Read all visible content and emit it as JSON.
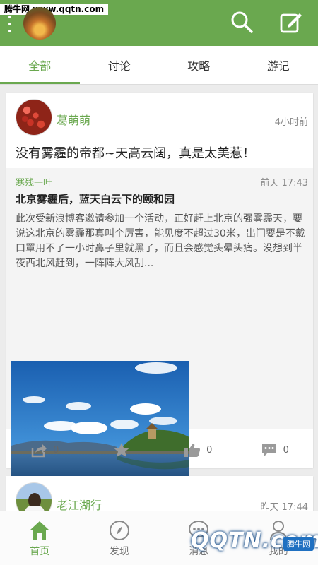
{
  "watermark": "腾牛网 www.qqtn.com",
  "tabs": [
    "全部",
    "讨论",
    "攻略",
    "游记"
  ],
  "posts": [
    {
      "user": "葛萌萌",
      "time": "4小时前",
      "title": "没有雾霾的帝都~天高云阔，真是太美惹！",
      "quote": {
        "author": "寒残一叶",
        "time": "前天 17:43",
        "title": "北京雾霾后，蓝天白云下的颐和园",
        "body": "此次受新浪博客邀请参加一个活动，正好赶上北京的强雾霾天，要说这北京的雾霾那真叫个厉害，能见度不超过30米，出门要是不戴口罩用不了一小时鼻子里就黑了，而且会感觉头晕头痛。没想到半夜西北风赶到，一阵阵大风刮..."
      },
      "actions": {
        "share_count": "0",
        "like_count": "0",
        "comment_count": "0"
      }
    },
    {
      "user": "老江湖行",
      "time": "昨天 17:44"
    }
  ],
  "bottom_nav": [
    "首页",
    "发现",
    "消息",
    "我的"
  ],
  "corner_badge": "腾牛网",
  "corner_logo": "QQTN.com",
  "colors": {
    "accent": "#6aa84f",
    "background": "#ececec"
  }
}
